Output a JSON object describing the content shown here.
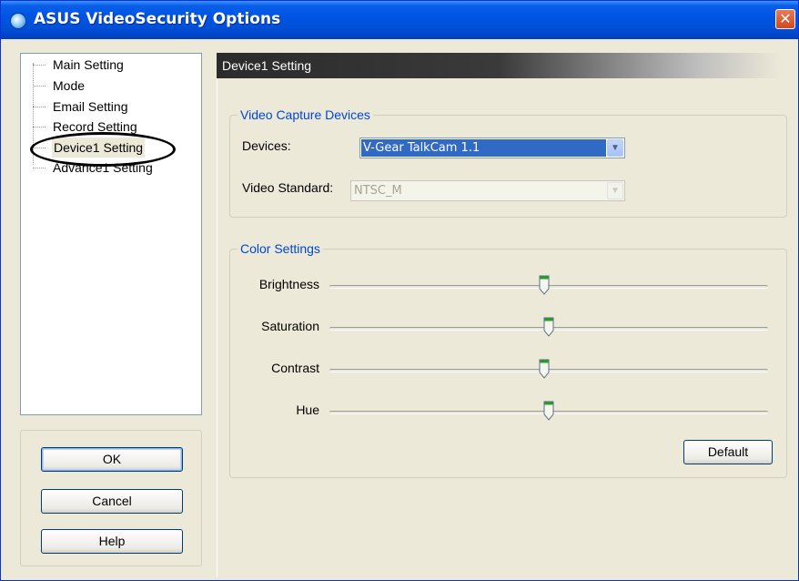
{
  "window": {
    "title": "ASUS VideoSecurity Options",
    "close_glyph": "✕"
  },
  "tree": {
    "items": [
      {
        "label": "Main Setting",
        "selected": false
      },
      {
        "label": "Mode",
        "selected": false
      },
      {
        "label": "Email Setting",
        "selected": false
      },
      {
        "label": "Record Setting",
        "selected": false
      },
      {
        "label": "Device1 Setting",
        "selected": true
      },
      {
        "label": "Advance1 Setting",
        "selected": false
      }
    ]
  },
  "buttons": {
    "ok": "OK",
    "cancel": "Cancel",
    "help": "Help"
  },
  "section": {
    "header": "Device1 Setting"
  },
  "capture": {
    "group_title": "Video Capture Devices",
    "devices_label": "Devices:",
    "devices_value": "V-Gear TalkCam 1.1",
    "standard_label": "Video Standard:",
    "standard_value": "NTSC_M"
  },
  "color": {
    "group_title": "Color Settings",
    "sliders": [
      {
        "label": "Brightness",
        "value": 0.49
      },
      {
        "label": "Saturation",
        "value": 0.5
      },
      {
        "label": "Contrast",
        "value": 0.49
      },
      {
        "label": "Hue",
        "value": 0.5
      }
    ],
    "default_label": "Default"
  },
  "colors": {
    "title_bar": "#0054e3",
    "accent_blue": "#0046d5",
    "selection": "#316ac5",
    "window_bg": "#ece9d8"
  }
}
